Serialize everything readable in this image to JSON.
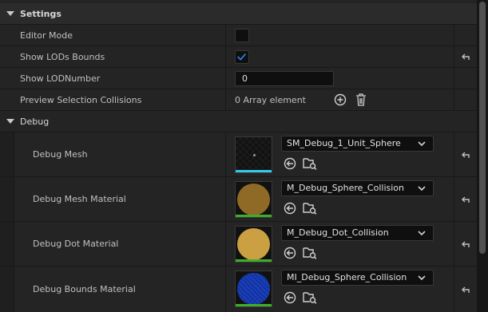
{
  "settings": {
    "title": "Settings",
    "rows": [
      {
        "label": "Editor Mode",
        "checked": false
      },
      {
        "label": "Show LODs Bounds",
        "checked": true
      },
      {
        "label": "Show LODNumber",
        "value": "0"
      },
      {
        "label": "Preview Selection Collisions",
        "value": "0 Array element"
      }
    ]
  },
  "debug": {
    "title": "Debug",
    "rows": [
      {
        "label": "Debug Mesh",
        "asset": "SM_Debug_1_Unit_Sphere",
        "thumb_color": "#000000",
        "bar_color": "#38c8e8"
      },
      {
        "label": "Debug Mesh Material",
        "asset": "M_Debug_Sphere_Collision",
        "thumb_color": "#8e6a26",
        "bar_color": "#3fae2a"
      },
      {
        "label": "Debug Dot Material",
        "asset": "M_Debug_Dot_Collision",
        "thumb_color": "#caa042",
        "bar_color": "#3fae2a"
      },
      {
        "label": "Debug Bounds Material",
        "asset": "MI_Debug_Sphere_Collision",
        "thumb_color": "#1638a8",
        "bar_color": "#3fae2a"
      }
    ]
  },
  "colors": {
    "accent": "#2a7ee8",
    "panel": "#242424",
    "field": "#0f0f0f"
  },
  "icons": [
    "chevron-down-icon",
    "check-icon",
    "reset-arrow-icon",
    "add-circle-icon",
    "trash-icon",
    "use-selected-arrow-icon",
    "browse-folder-icon"
  ]
}
